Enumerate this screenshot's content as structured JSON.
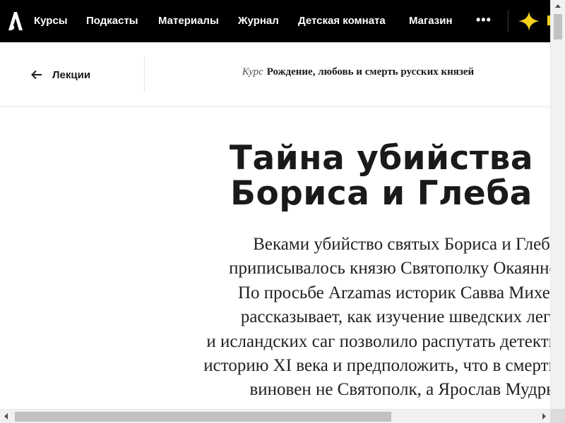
{
  "nav": {
    "logo_icon": "arzamas-logo-icon",
    "items": [
      {
        "label": "Курсы"
      },
      {
        "label": "Подкасты"
      },
      {
        "label": "Материалы"
      },
      {
        "label": "Журнал"
      },
      {
        "label": "Детская комната"
      },
      {
        "label": "Магазин"
      }
    ],
    "more_label": "•••",
    "accent_icon": "sparkle-star-icon",
    "accent_color": "#f5d11e"
  },
  "subheader": {
    "back_label": "Лекции",
    "course_prefix": "Курс",
    "course_title": "Рождение, любовь и смерть русских князей"
  },
  "article": {
    "title_lines": [
      "Тайна убийства",
      "Бориса и Глеба"
    ],
    "lead_lines": [
      "Веками убийство святых Бориса и Глеба",
      "приписывалось князю Святополку Окаянно",
      "По просьбе Arzamas историк Савва Михее",
      "рассказывает, как изучение шведских леге",
      "и исландских саг позволило распутать детекти",
      "историю XI века и предположить, что в смерти",
      "виновен не Святополк, а Ярослав Мудры"
    ]
  }
}
